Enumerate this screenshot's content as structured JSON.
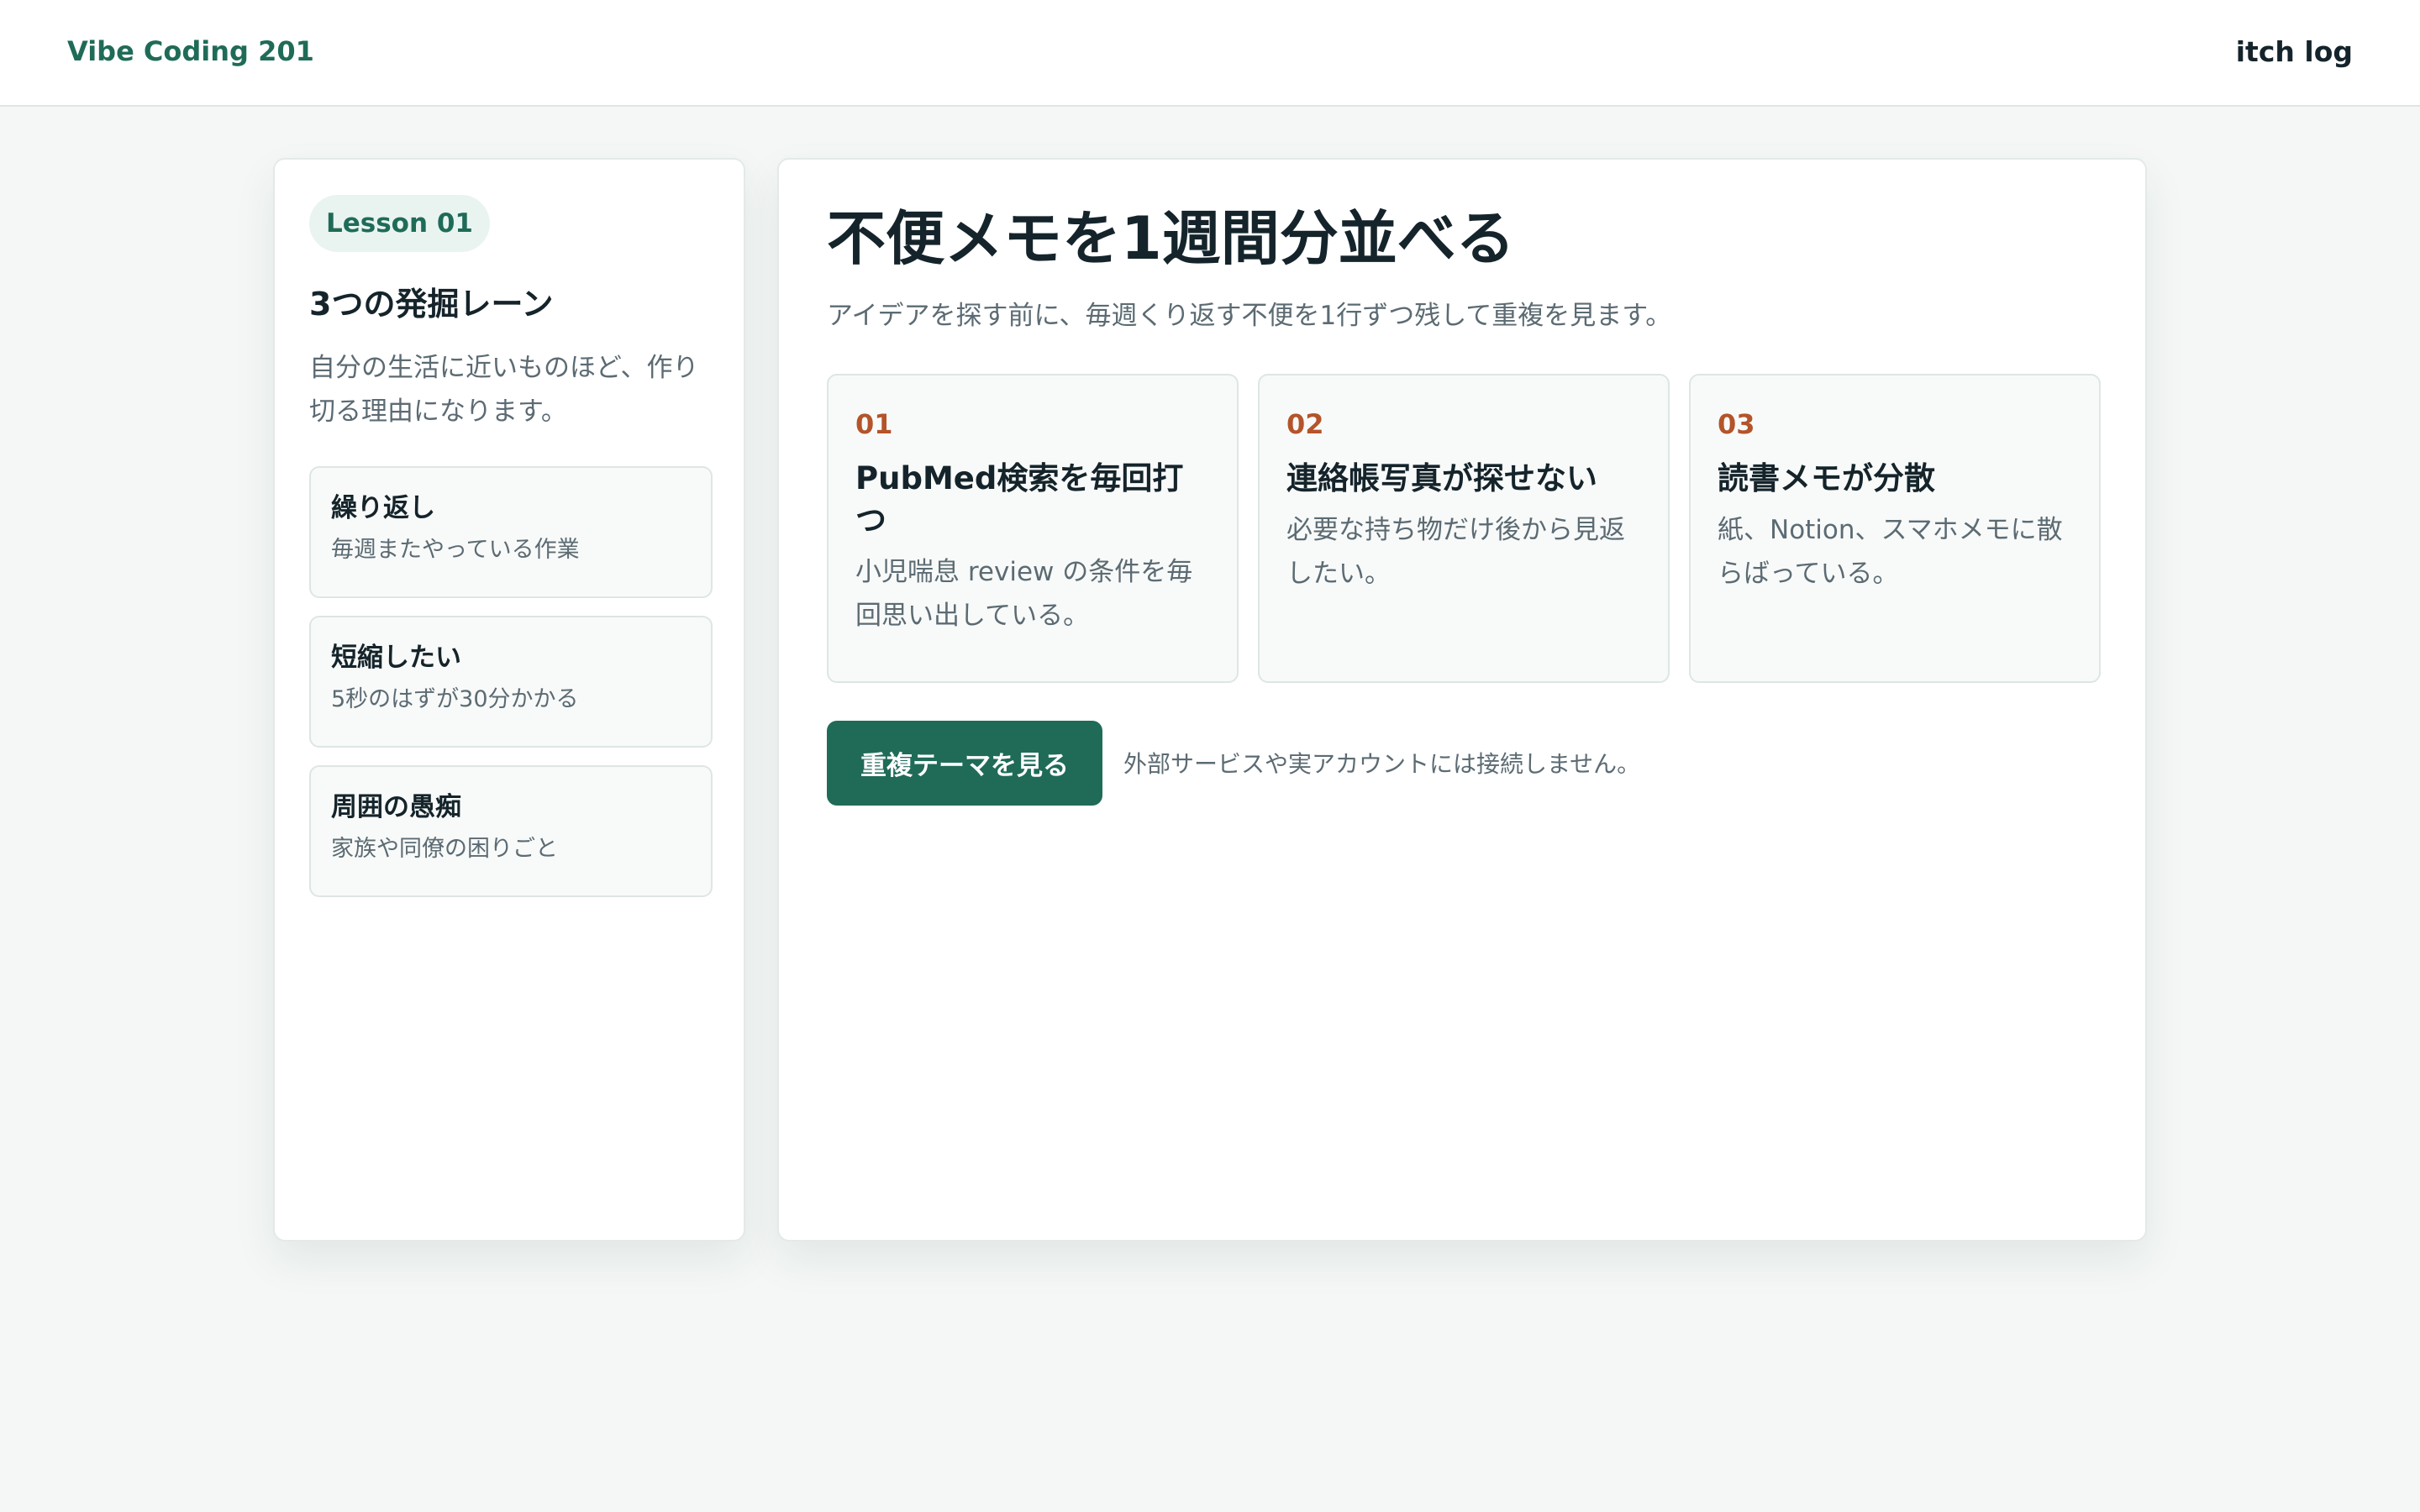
{
  "header": {
    "brand": "Vibe Coding 201",
    "link": "itch log"
  },
  "sidebar": {
    "lesson_badge": "Lesson 01",
    "title": "3つの発掘レーン",
    "description": "自分の生活に近いものほど、作り切る理由になります。",
    "lanes": [
      {
        "title": "繰り返し",
        "subtitle": "毎週またやっている作業"
      },
      {
        "title": "短縮したい",
        "subtitle": "5秒のはずが30分かかる"
      },
      {
        "title": "周囲の愚痴",
        "subtitle": "家族や同僚の困りごと"
      }
    ]
  },
  "main": {
    "title": "不便メモを1週間分並べる",
    "subtitle": "アイデアを探す前に、毎週くり返す不便を1行ずつ残して重複を見ます。",
    "notes": [
      {
        "number": "01",
        "title": "PubMed検索を毎回打つ",
        "body": "小児喘息 review の条件を毎回思い出している。"
      },
      {
        "number": "02",
        "title": "連絡帳写真が探せない",
        "body": "必要な持ち物だけ後から見返したい。"
      },
      {
        "number": "03",
        "title": "読書メモが分散",
        "body": "紙、Notion、スマホメモに散らばっている。"
      }
    ],
    "action_button": "重複テーマを見る",
    "action_note": "外部サービスや実アカウントには接続しません。"
  },
  "colors": {
    "accent": "#1f6b58",
    "number_accent": "#b4542a",
    "background": "#f4f7f6"
  }
}
